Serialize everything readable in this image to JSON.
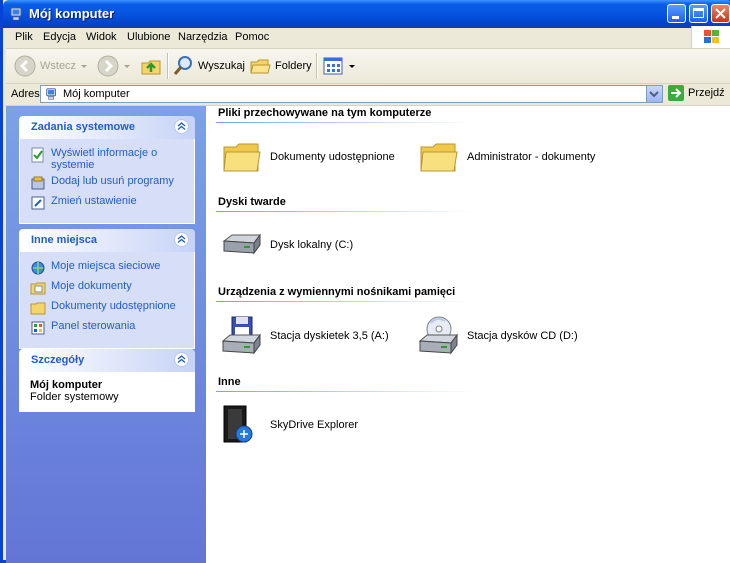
{
  "window": {
    "title": "Mój komputer"
  },
  "menu": [
    "Plik",
    "Edycja",
    "Widok",
    "Ulubione",
    "Narzędzia",
    "Pomoc"
  ],
  "toolbar": {
    "back_label": "Wstecz",
    "search_label": "Wyszukaj",
    "folders_label": "Foldery"
  },
  "address": {
    "label": "Adres",
    "value": "Mój komputer",
    "go_label": "Przejdź"
  },
  "left": {
    "system_tasks": {
      "title": "Zadania systemowe",
      "items": [
        "Wyświetl informacje o systemie",
        "Dodaj lub usuń programy",
        "Zmień ustawienie"
      ]
    },
    "other_places": {
      "title": "Inne miejsca",
      "items": [
        "Moje miejsca sieciowe",
        "Moje dokumenty",
        "Dokumenty udostępnione",
        "Panel sterowania"
      ]
    },
    "details": {
      "title": "Szczegóły",
      "name": "Mój komputer",
      "type": "Folder systemowy"
    }
  },
  "content": {
    "sections": [
      {
        "title": "Pliki przechowywane na tym komputerze",
        "items": [
          "Dokumenty udostępnione",
          "Administrator - dokumenty"
        ]
      },
      {
        "title": "Dyski twarde",
        "items": [
          "Dysk lokalny (C:)"
        ]
      },
      {
        "title": "Urządzenia z wymiennymi nośnikami pamięci",
        "items": [
          "Stacja dyskietek 3,5 (A:)",
          "Stacja dysków CD (D:)"
        ]
      },
      {
        "title": "Inne",
        "items": [
          "SkyDrive Explorer"
        ]
      }
    ]
  },
  "colors": {
    "titlebar": "#0553df",
    "accent_blue": "#215dc6",
    "left_pane": "#7ba2e7"
  }
}
